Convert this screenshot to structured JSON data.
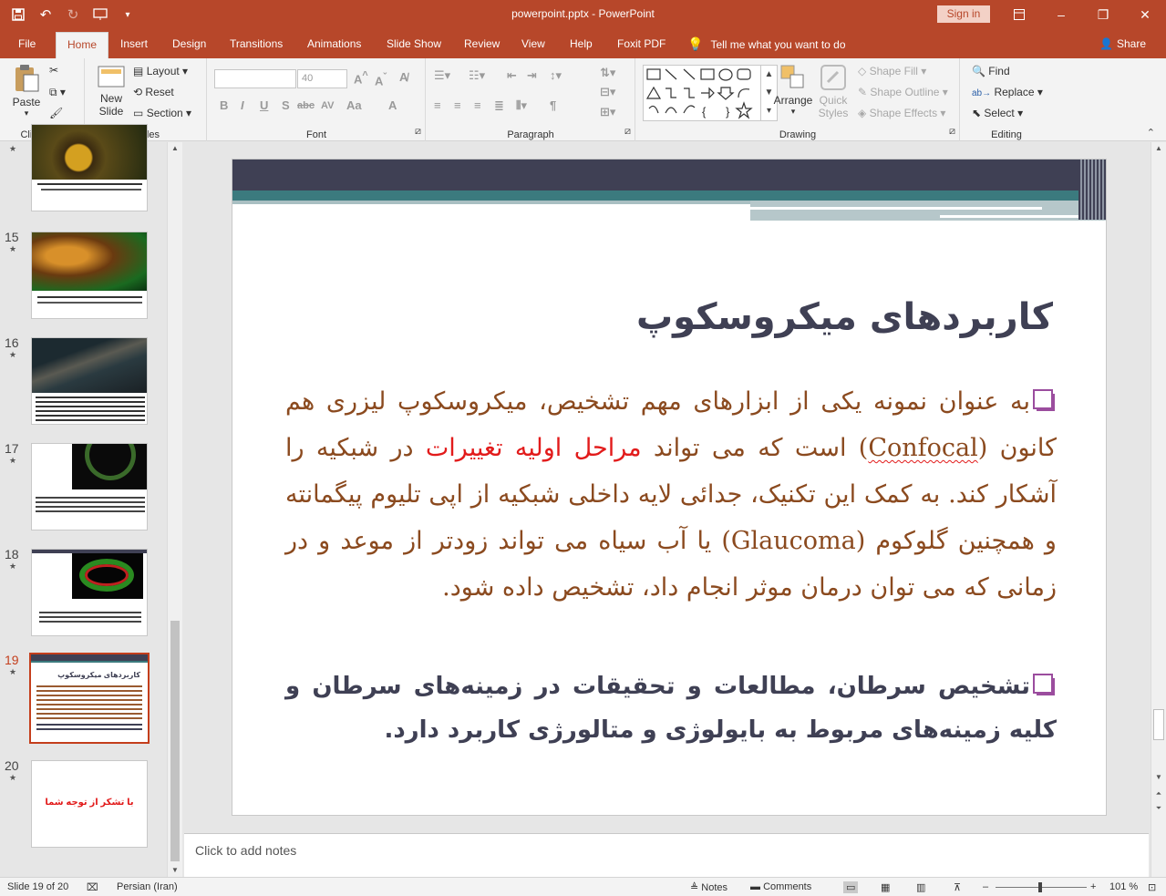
{
  "titlebar": {
    "title": "powerpoint.pptx  -  PowerPoint",
    "signin": "Sign in",
    "qat_icons": [
      "save-icon",
      "undo-icon",
      "redo-icon",
      "start-from-beginning-icon",
      "customize-qat-icon"
    ]
  },
  "tabs": [
    "File",
    "Home",
    "Insert",
    "Design",
    "Transitions",
    "Animations",
    "Slide Show",
    "Review",
    "View",
    "Help",
    "Foxit PDF"
  ],
  "active_tab": "Home",
  "tell_me": "Tell me what you want to do",
  "share": "Share",
  "ribbon": {
    "clipboard": {
      "paste": "Paste",
      "label": "Clipboard"
    },
    "slides": {
      "new_slide_1": "New",
      "new_slide_2": "Slide",
      "layout": "Layout",
      "reset": "Reset",
      "section": "Section",
      "label": "Slides"
    },
    "font": {
      "font_name": "",
      "font_size": "40",
      "label": "Font",
      "buttons": [
        "B",
        "I",
        "U",
        "S",
        "abc",
        "AV",
        "Aa",
        "A"
      ]
    },
    "paragraph": {
      "label": "Paragraph"
    },
    "drawing": {
      "arrange": "Arrange",
      "quick_styles_1": "Quick",
      "quick_styles_2": "Styles",
      "shape_fill": "Shape Fill",
      "shape_outline": "Shape Outline",
      "shape_effects": "Shape Effects",
      "label": "Drawing"
    },
    "editing": {
      "find": "Find",
      "replace": "Replace",
      "select": "Select",
      "label": "Editing"
    }
  },
  "thumbnails": [
    {
      "num": "15"
    },
    {
      "num": "16"
    },
    {
      "num": "17"
    },
    {
      "num": "18"
    },
    {
      "num": "19",
      "title": "کاربردهای میکروسکوپ"
    },
    {
      "num": "20",
      "text": "با تشکر از توجه شما"
    }
  ],
  "slide": {
    "title": "کاربردهای میکروسکوپ",
    "para1_a": "به عنوان نمونه یکی از ابزارهای مهم تشخیص، میکروسکوپ لیزری هم کانون (",
    "para1_confocal": "Confocal",
    "para1_b": ") است که می تواند ",
    "para1_red": "مراحل اولیه تغییرات",
    "para1_c": " در شبکیه را آشکار کند. به کمک این تکنیک، جدائی لایه داخلی شبکیه از اپی تلیوم پیگمانته و  همچنین گلوکوم (Glaucoma) یا آب سیاه می تواند زودتر از موعد و در زمانی که می توان درمان موثر انجام داد، تشخیص داده شود.",
    "para2": "تشخیص  سرطان، مطالعات و تحقیقات در زمینه‌های سرطان و کلیه زمینه‌های مربوط به بایولوژی و متالورژی کاربرد دارد."
  },
  "notes_placeholder": "Click to add notes",
  "status": {
    "slide_info": "Slide 19 of 20",
    "language": "Persian (Iran)",
    "notes": "Notes",
    "comments": "Comments",
    "zoom": "101 %"
  }
}
